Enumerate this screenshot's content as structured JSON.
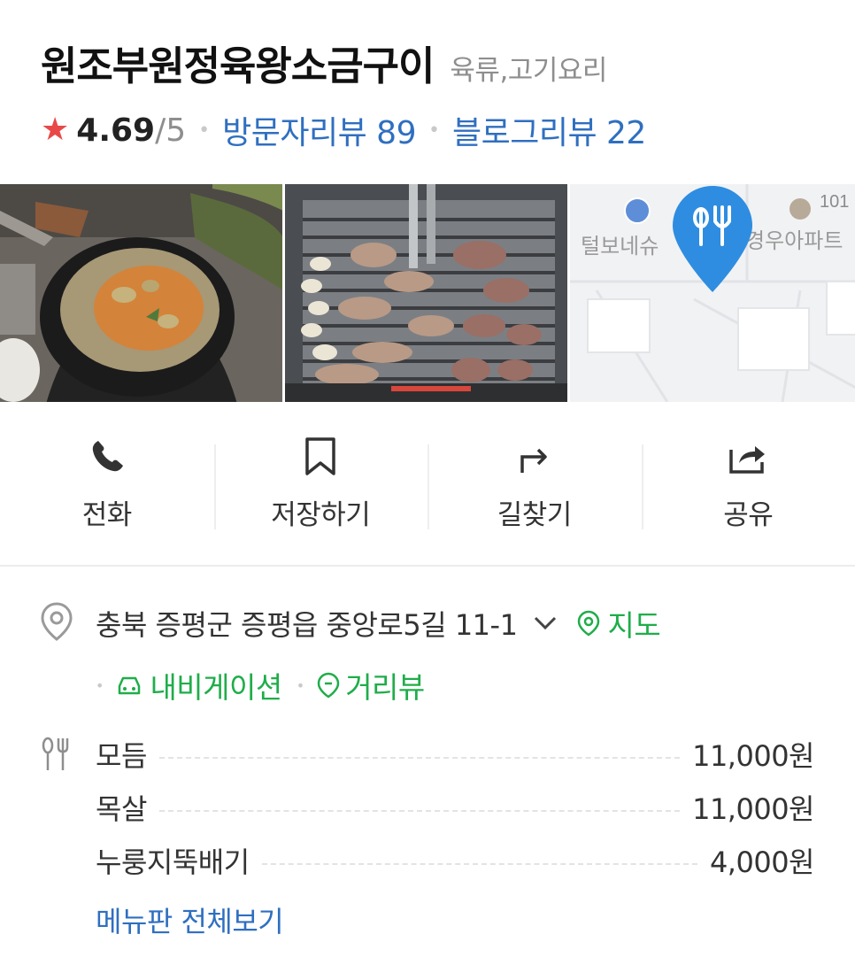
{
  "place": {
    "name": "원조부원정육왕소금구이",
    "category": "육류,고기요리",
    "rating": "4.69",
    "rating_max": "/5",
    "visitor_reviews": "방문자리뷰 89",
    "blog_reviews": "블로그리뷰 22"
  },
  "photos": [
    {
      "subject": "soybean stew on table"
    },
    {
      "subject": "pork on grill"
    },
    {
      "subject": "map",
      "labels": [
        "털보네슈",
        "경우아파트",
        "101"
      ]
    }
  ],
  "actions": [
    {
      "label": "전화",
      "icon": "phone-icon"
    },
    {
      "label": "저장하기",
      "icon": "bookmark-icon"
    },
    {
      "label": "길찾기",
      "icon": "directions-icon"
    },
    {
      "label": "공유",
      "icon": "share-icon"
    }
  ],
  "address": {
    "text": "충북 증평군 증평읍 중앙로5길 11-1",
    "map_link": "지도",
    "navigation_link": "내비게이션",
    "streetview_link": "거리뷰"
  },
  "menu": {
    "items": [
      {
        "name": "모듬",
        "price": "11,000원"
      },
      {
        "name": "목살",
        "price": "11,000원"
      },
      {
        "name": "누룽지뚝배기",
        "price": "4,000원"
      }
    ],
    "view_all": "메뉴판 전체보기"
  },
  "colors": {
    "star": "#e94848",
    "link_blue": "#2f6fc0",
    "green": "#1fad4a",
    "map_pin": "#2e8de0"
  }
}
